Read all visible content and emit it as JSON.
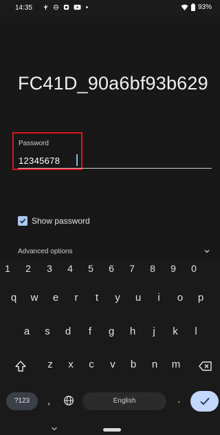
{
  "status_bar": {
    "time": "14:35",
    "battery_percent": "93%",
    "left_icons": [
      "usb-icon",
      "vpn-icon",
      "record-icon",
      "youtube-icon",
      "dot-icon"
    ],
    "right_icons": [
      "wifi-icon",
      "battery-icon"
    ]
  },
  "dialog": {
    "network_name": "FC41D_90a6bf93b629",
    "password_label": "Password",
    "password_value": "12345678",
    "show_password_label": "Show password",
    "show_password_checked": true,
    "advanced_options_label": "Advanced options"
  },
  "keyboard": {
    "number_row": [
      "1",
      "2",
      "3",
      "4",
      "5",
      "6",
      "7",
      "8",
      "9",
      "0"
    ],
    "row1": [
      "q",
      "w",
      "e",
      "r",
      "t",
      "y",
      "u",
      "i",
      "o",
      "p"
    ],
    "row2": [
      "a",
      "s",
      "d",
      "f",
      "g",
      "h",
      "j",
      "k",
      "l"
    ],
    "row3": [
      "z",
      "x",
      "c",
      "v",
      "b",
      "n",
      "m"
    ],
    "symbols_label": "?123",
    "comma": ",",
    "space_label": "English",
    "period": "."
  },
  "colors": {
    "accent": "#a8c7fa",
    "highlight_box": "#e0141f",
    "enter_key": "#c2d7fb"
  }
}
